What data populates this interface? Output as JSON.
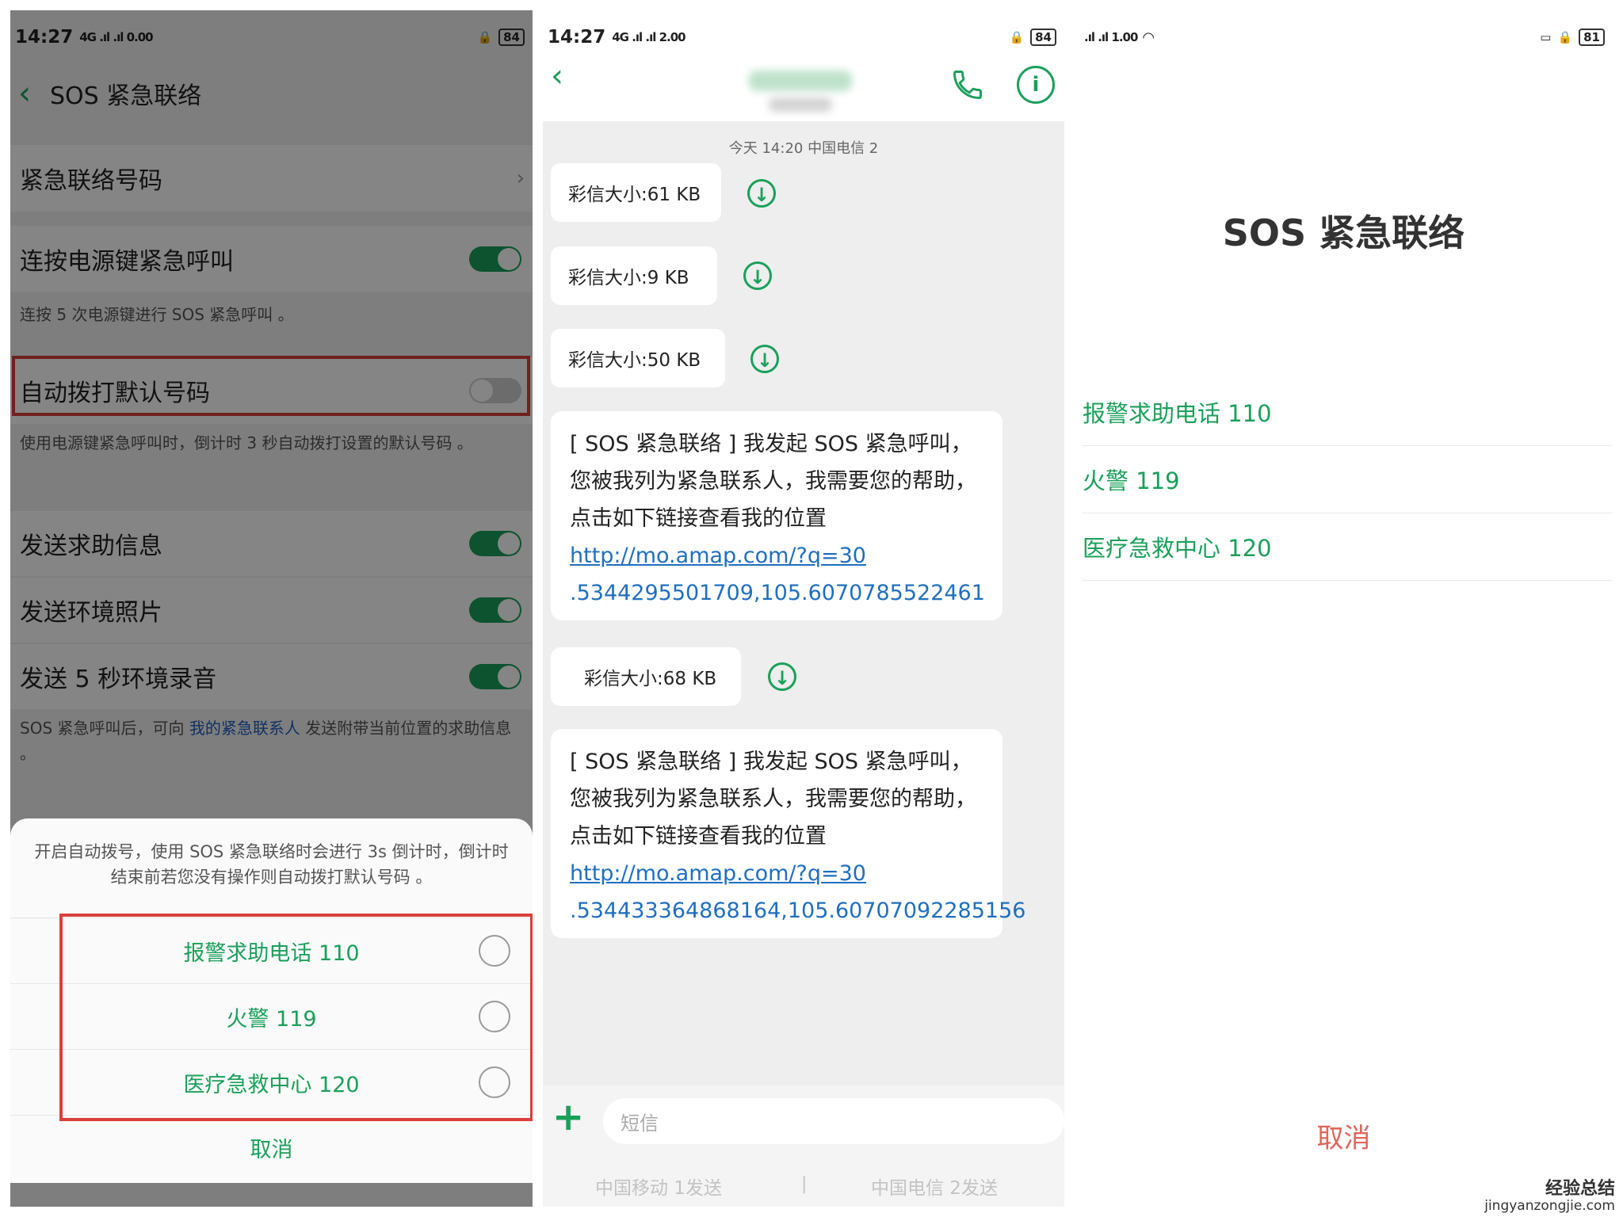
{
  "panel1": {
    "status": {
      "time": "14:27",
      "net": "4G .ıl .ıl 0.00",
      "battery": "84"
    },
    "header": {
      "title": "SOS 紧急联络"
    },
    "rows": {
      "emergency_number": "紧急联络号码",
      "power_press": "连按电源键紧急呼叫",
      "power_press_note": "连按 5 次电源键进行 SOS 紧急呼叫 。",
      "auto_dial": "自动拨打默认号码",
      "auto_dial_note": "使用电源键紧急呼叫时，倒计时 3 秒自动拨打设置的默认号码 。",
      "send_help": "发送求助信息",
      "send_photo": "发送环境照片",
      "send_audio": "发送 5 秒环境录音",
      "send_note_a": "SOS 紧急呼叫后，可向 ",
      "send_note_link": "我的紧急联系人",
      "send_note_b": " 发送附带当前位置的求助信息 。"
    },
    "sheet": {
      "desc": "开启自动拨号，使用 SOS 紧急联络时会进行 3s 倒计时，倒计时结束前若您没有操作则自动拨打默认号码 。",
      "options": [
        "报警求助电话 110",
        "火警 119",
        "医疗急救中心 120"
      ],
      "cancel": "取消"
    }
  },
  "panel2": {
    "status": {
      "time": "14:27",
      "net": "4G .ıl .ıl 2.00",
      "battery": "84"
    },
    "timestamp": "今天 14:20  中国电信 2",
    "mms": [
      "彩信大小:61 KB",
      "彩信大小:9 KB",
      "彩信大小:50 KB",
      "彩信大小:68 KB"
    ],
    "messages": [
      {
        "text": "[ SOS 紧急联络 ] 我发起 SOS 紧急呼叫，您被我列为紧急联系人，我需要您的帮助，点击如下链接查看我的位置 ",
        "url_a": "http://mo.amap.com/?q=30",
        "url_b": ".5344295501709,105.6070785522461"
      },
      {
        "text": "[ SOS 紧急联络 ] 我发起 SOS 紧急呼叫，您被我列为紧急联系人，我需要您的帮助，点击如下链接查看我的位置 ",
        "url_a": "http://mo.amap.com/?q=30",
        "url_b": ".534433364868164,105.60707092285156"
      }
    ],
    "compose_placeholder": "短信",
    "send_1": "中国移动 1发送",
    "send_2": "中国电信 2发送"
  },
  "panel3": {
    "status": {
      "net": ".ıl .ıl 1.00",
      "battery": "81"
    },
    "title": "SOS 紧急联络",
    "options": [
      "报警求助电话 110",
      "火警 119",
      "医疗急救中心 120"
    ],
    "cancel": "取消"
  },
  "watermark": {
    "line1": "经验总结",
    "line2": "jingyanzongjie.com"
  }
}
